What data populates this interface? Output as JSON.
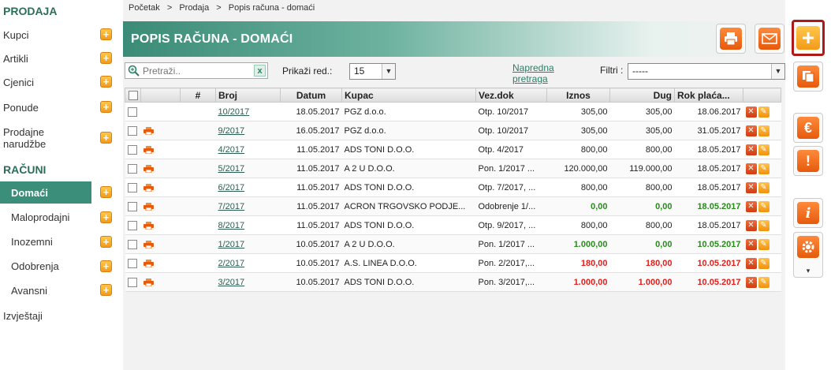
{
  "sidebar": {
    "heading_sales": "PRODAJA",
    "sales_items": [
      {
        "label": "Kupci"
      },
      {
        "label": "Artikli"
      },
      {
        "label": "Cjenici"
      },
      {
        "label": "Ponude"
      },
      {
        "label": "Prodajne narudžbe"
      }
    ],
    "heading_invoices": "RAČUNI",
    "invoice_items": [
      {
        "label": "Domaći",
        "active": true
      },
      {
        "label": "Maloprodajni"
      },
      {
        "label": "Inozemni"
      },
      {
        "label": "Odobrenja"
      },
      {
        "label": "Avansni"
      }
    ],
    "reports": "Izvještaji",
    "plus_glyph": "+"
  },
  "breadcrumb": [
    "Početak",
    ">",
    "Prodaja",
    ">",
    "Popis računa - domaći"
  ],
  "page": {
    "title": "POPIS RAČUNA - DOMAĆI"
  },
  "filters": {
    "search_placeholder": "Pretraži..",
    "clear_glyph": "x",
    "rows_label": "Prikaži red.:",
    "rows_value": "15",
    "advanced_line1": "Napredna",
    "advanced_line2": "pretraga",
    "filter_label": "Filtri :",
    "filter_value": "-----"
  },
  "table": {
    "headers": {
      "hash": "#",
      "broj": "Broj",
      "datum": "Datum",
      "kupac": "Kupac",
      "vezdok": "Vez.dok",
      "iznos": "Iznos",
      "dug": "Dug",
      "rok": "Rok plaća..."
    },
    "rows": [
      {
        "broj": "10/2017",
        "datum": "18.05.2017",
        "kupac": "PGZ d.o.o.",
        "vezdok": "Otp. 10/2017",
        "iznos": "305,00",
        "dug": "305,00",
        "rok": "18.06.2017",
        "status": "normal",
        "print": false
      },
      {
        "broj": "9/2017",
        "datum": "16.05.2017",
        "kupac": "PGZ d.o.o.",
        "vezdok": "Otp. 10/2017",
        "iznos": "305,00",
        "dug": "305,00",
        "rok": "31.05.2017",
        "status": "normal",
        "print": true
      },
      {
        "broj": "4/2017",
        "datum": "11.05.2017",
        "kupac": "ADS TONI D.O.O.",
        "vezdok": "Otp. 4/2017",
        "iznos": "800,00",
        "dug": "800,00",
        "rok": "18.05.2017",
        "status": "normal",
        "print": true
      },
      {
        "broj": "5/2017",
        "datum": "11.05.2017",
        "kupac": "A 2 U D.O.O.",
        "vezdok": "Pon. 1/2017 ...",
        "iznos": "120.000,00",
        "dug": "119.000,00",
        "rok": "18.05.2017",
        "status": "normal",
        "print": true
      },
      {
        "broj": "6/2017",
        "datum": "11.05.2017",
        "kupac": "ADS TONI D.O.O.",
        "vezdok": "Otp. 7/2017, ...",
        "iznos": "800,00",
        "dug": "800,00",
        "rok": "18.05.2017",
        "status": "normal",
        "print": true
      },
      {
        "broj": "7/2017",
        "datum": "11.05.2017",
        "kupac": "ACRON TRGOVSKO PODJE...",
        "vezdok": "Odobrenje 1/...",
        "iznos": "0,00",
        "dug": "0,00",
        "rok": "18.05.2017",
        "status": "green",
        "print": true
      },
      {
        "broj": "8/2017",
        "datum": "11.05.2017",
        "kupac": "ADS TONI D.O.O.",
        "vezdok": "Otp. 9/2017, ...",
        "iznos": "800,00",
        "dug": "800,00",
        "rok": "18.05.2017",
        "status": "normal",
        "print": true
      },
      {
        "broj": "1/2017",
        "datum": "10.05.2017",
        "kupac": "A 2 U D.O.O.",
        "vezdok": "Pon. 1/2017 ...",
        "iznos": "1.000,00",
        "dug": "0,00",
        "rok": "10.05.2017",
        "status": "green",
        "print": true
      },
      {
        "broj": "2/2017",
        "datum": "10.05.2017",
        "kupac": "A.S. LINEA D.O.O.",
        "vezdok": "Pon. 2/2017,...",
        "iznos": "180,00",
        "dug": "180,00",
        "rok": "10.05.2017",
        "status": "red",
        "print": true
      },
      {
        "broj": "3/2017",
        "datum": "10.05.2017",
        "kupac": "ADS TONI D.O.O.",
        "vezdok": "Pon. 3/2017,...",
        "iznos": "1.000,00",
        "dug": "1.000,00",
        "rok": "10.05.2017",
        "status": "red",
        "print": true
      }
    ],
    "delete_glyph": "✕",
    "edit_glyph": "✎"
  },
  "toolbar": {
    "print_icon": "printer-icon",
    "email_icon": "envelope-icon",
    "add_glyph": "+",
    "euro_glyph": "€",
    "warning_glyph": "!",
    "info_glyph": "i",
    "more_glyph": "▾"
  },
  "colors": {
    "accent": "#3b8f7a",
    "orange": "#e65a0c",
    "green": "#2a8a1e",
    "red": "#e0201c",
    "highlight_border": "#b01818"
  }
}
